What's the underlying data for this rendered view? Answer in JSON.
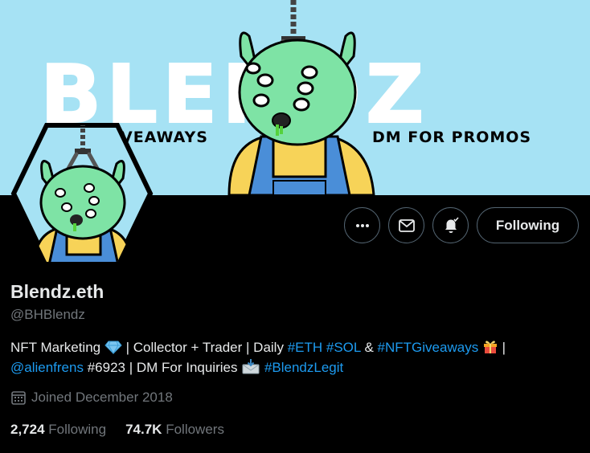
{
  "banner": {
    "big_word": "BLENDZ",
    "sub_left": "VEAWAYS",
    "sub_right": "DM FOR PROMOS"
  },
  "profile": {
    "display_name": "Blendz.eth",
    "handle": "@BHBlendz",
    "bio": {
      "line1_a": "NFT Marketing",
      "line1_b": "| Collector + Trader | Daily",
      "tag_eth": "#ETH",
      "tag_sol": "#SOL",
      "amp": "&",
      "tag_giveaways": "#NFTGiveaways",
      "pipe": "|",
      "mention": "@alienfrens",
      "line2_b": "#6923 | DM For Inquiries",
      "tag_legit": "#BlendzLegit"
    },
    "joined": "Joined December 2018",
    "following_count": "2,724",
    "following_label": "Following",
    "followers_count": "74.7K",
    "followers_label": "Followers"
  },
  "actions": {
    "follow_label": "Following"
  },
  "icons": {
    "more": "more-icon",
    "mail": "mail-icon",
    "notifications": "bell-icon",
    "calendar": "calendar-icon"
  },
  "colors": {
    "banner_bg": "#a6e2f4",
    "link": "#1d9bf0",
    "muted": "#71767b",
    "text": "#e7e9ea",
    "alien_green": "#7ee3a5",
    "shirt_yellow": "#f7d358",
    "overalls_blue": "#4a8ed8"
  }
}
